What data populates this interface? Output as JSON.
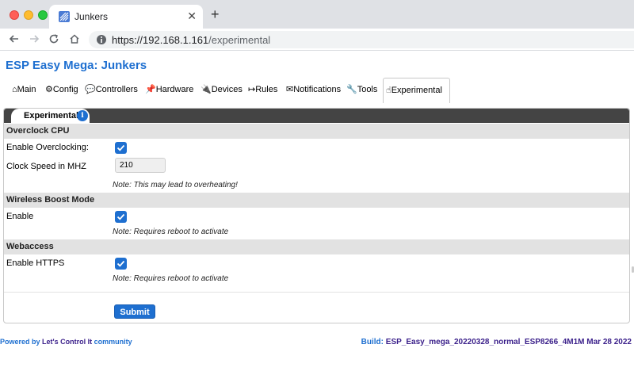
{
  "browser": {
    "tab_title": "Junkers",
    "tab_close": "✕",
    "new_tab": "+",
    "url_host": "https://192.168.1.161",
    "url_path": "/experimental"
  },
  "page": {
    "title": "ESP Easy Mega: Junkers"
  },
  "menu": {
    "items": [
      {
        "label": "⌂Main"
      },
      {
        "label": "⚙Config"
      },
      {
        "label": "💬Controllers"
      },
      {
        "label": "📌Hardware"
      },
      {
        "label": "🔌Devices"
      },
      {
        "label": "↦Rules"
      },
      {
        "label": "✉Notifications"
      },
      {
        "label": "🔧Tools"
      },
      {
        "label": "☝Experimental"
      }
    ],
    "active": "Experimental"
  },
  "card": {
    "title": "Experimental",
    "info_icon": "i",
    "sections": [
      {
        "header": "Overclock CPU"
      },
      {
        "header": "Wireless Boost Mode"
      },
      {
        "header": "Webaccess"
      }
    ],
    "overclock": {
      "enable_label": "Enable Overclocking:",
      "enable_checked": true,
      "speed_label": "Clock Speed in MHZ",
      "speed_value": "210",
      "note": "Note: This may lead to overheating!"
    },
    "wireless": {
      "enable_label": "Enable",
      "enable_checked": true,
      "note": "Note: Requires reboot to activate"
    },
    "webaccess": {
      "enable_label": "Enable HTTPS",
      "enable_checked": true,
      "note": "Note: Requires reboot to activate"
    },
    "submit_label": "Submit"
  },
  "footer": {
    "powered_prefix": "Powered by ",
    "powered_name": "Let's Control It",
    "powered_suffix": " community",
    "build_prefix": "Build: ",
    "build_value": "ESP_Easy_mega_20220328_normal_ESP8266_4M1M Mar 28 2022"
  },
  "colors": {
    "accent": "#1e6fd0",
    "header_bar": "#444444",
    "section_bg": "#e2e2e2"
  }
}
